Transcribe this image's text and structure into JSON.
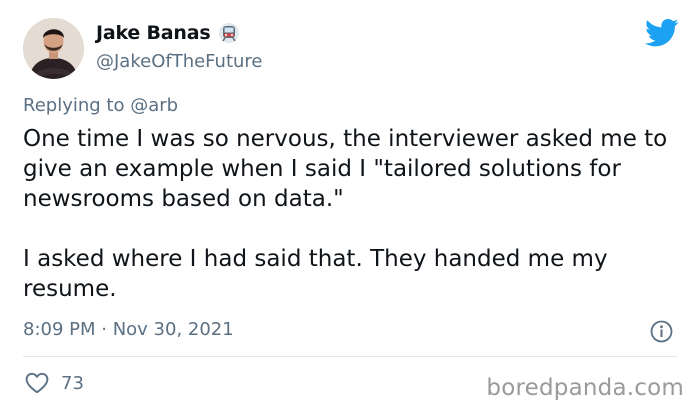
{
  "author": {
    "display_name": "Jake Banas",
    "handle": "@JakeOfTheFuture",
    "name_emoji": "train-emoji"
  },
  "brand_icon": "twitter-bird-icon",
  "reply_context": {
    "prefix": "Replying to",
    "mention": "@arb"
  },
  "tweet": {
    "paragraph_1": "One time I was so nervous, the interviewer asked me to give an example when I said I \"tailored solutions for newsrooms based on data.\"",
    "paragraph_2": "I asked where I had said that. They handed me my resume."
  },
  "meta": {
    "timestamp": "8:09 PM · Nov 30, 2021",
    "info_icon": "info-icon"
  },
  "actions": {
    "like_icon": "heart-icon",
    "like_count": "73"
  },
  "watermark": "boredpanda.com",
  "colors": {
    "text_primary": "#0f1419",
    "text_secondary": "#5b7083",
    "twitter_blue": "#1da1f2",
    "divider": "#e1e8ed",
    "watermark": "#9a9a9a"
  }
}
